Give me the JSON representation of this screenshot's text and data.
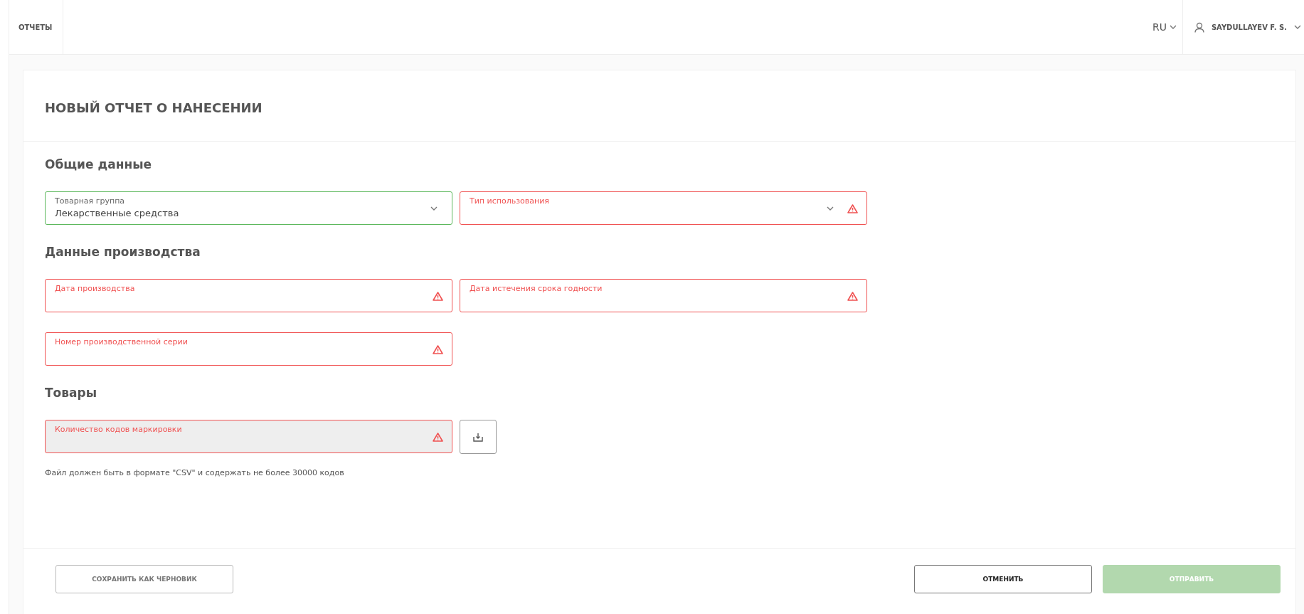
{
  "header": {
    "nav_item": "ОТЧЕТЫ",
    "language": "RU",
    "user": "SAYDULLAYEV F. S."
  },
  "form": {
    "title": "НОВЫЙ ОТЧЕТ О НАНЕСЕНИИ",
    "sections": [
      {
        "heading": "Общие данные",
        "rows": [
          [
            {
              "label": "Товарная группа",
              "value": "Лекарственные средства",
              "invalid": false,
              "kind": "dropdown",
              "disabled": false
            },
            {
              "label": "Тип использования",
              "invalid": true,
              "kind": "dropdown",
              "disabled": false
            }
          ]
        ]
      },
      {
        "heading": "Данные производства",
        "rows": [
          [
            {
              "label": "Дата производства",
              "invalid": true,
              "kind": "text",
              "disabled": false
            },
            {
              "label": "Дата истечения срока годности",
              "invalid": true,
              "kind": "text",
              "disabled": false
            }
          ],
          [
            {
              "label": "Номер производственной серии",
              "invalid": true,
              "kind": "text",
              "disabled": false
            }
          ]
        ]
      },
      {
        "heading": "Товары",
        "rows": [
          [
            {
              "label": "Количество кодов маркировки",
              "invalid": true,
              "kind": "text",
              "disabled": true
            },
            {
              "kind": "upload"
            }
          ]
        ],
        "hint": "Файл должен быть в формате \"CSV\" и содержать не более 30000 кодов"
      }
    ]
  },
  "footer": {
    "draft_button": "СОХРАНИТЬ КАК ЧЕРНОВИК",
    "cancel_button": "ОТМЕНИТЬ",
    "submit_button": {
      "label": "ОТПРАВИТЬ",
      "disabled": true
    }
  }
}
